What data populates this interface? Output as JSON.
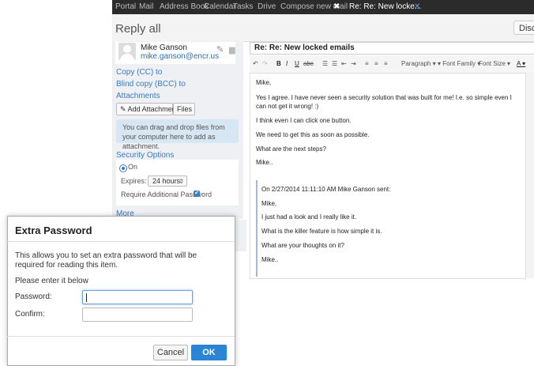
{
  "topbar": {
    "tabs": [
      "Portal",
      "Mail",
      "Address Book",
      "Calendar",
      "Tasks",
      "Drive",
      "Compose new mail",
      "Re: Re: New locke..."
    ],
    "pin_icon": "pin-icon",
    "close_icon": "close-icon"
  },
  "header": {
    "title": "Reply all",
    "discard_label": "Discard"
  },
  "sender": {
    "name": "Mike Ganson",
    "email": "mike.ganson@encr.us"
  },
  "left": {
    "cc_link": "Copy (CC) to",
    "bcc_link": "Blind copy (BCC) to",
    "attachments_link": "Attachments",
    "add_attachment": "Add Attachment",
    "files": "Files",
    "drop_hint": "You can drag and drop files from your computer here to add as attachment.",
    "security_link": "Security Options",
    "on_label": "On",
    "expires_label": "Expires:",
    "expires_value": "24 hours",
    "require_label": "Require Additional Password",
    "more_link": "More"
  },
  "compose": {
    "subject": "Re: Re: New locked emails",
    "toolbar": {
      "paragraph": "Paragraph",
      "font_family": "Font Family",
      "font_size": "Font Size"
    },
    "body": [
      "Mike,",
      "Yes I agree. I have never seen a security solution that was built for me! I.e. so simple even I can not get it wrong! :)",
      "I think even I can click one button.",
      "We need to get this as soon as possible.",
      "What are the next steps?",
      "Mike.."
    ],
    "quote": [
      "On 2/27/2014 11:11:10 AM Mike Ganson sent:",
      "Mike,",
      "I just had a look and I really like it.",
      "What is the killer feature is how simple it is.",
      "What are your thoughts on it?",
      "Mike.."
    ]
  },
  "dialog": {
    "title": "Extra Password",
    "description": "This allows you to set an extra password that will be required for reading this item.",
    "prompt": "Please enter it below",
    "password_label": "Password:",
    "confirm_label": "Confirm:",
    "password_value": "",
    "confirm_value": "",
    "cancel_label": "Cancel",
    "ok_label": "OK"
  },
  "colors": {
    "accent": "#2b85d4",
    "link": "#3b7bbf",
    "drop_bg": "#d7e6f3",
    "topbar": "#2b2b2b"
  }
}
